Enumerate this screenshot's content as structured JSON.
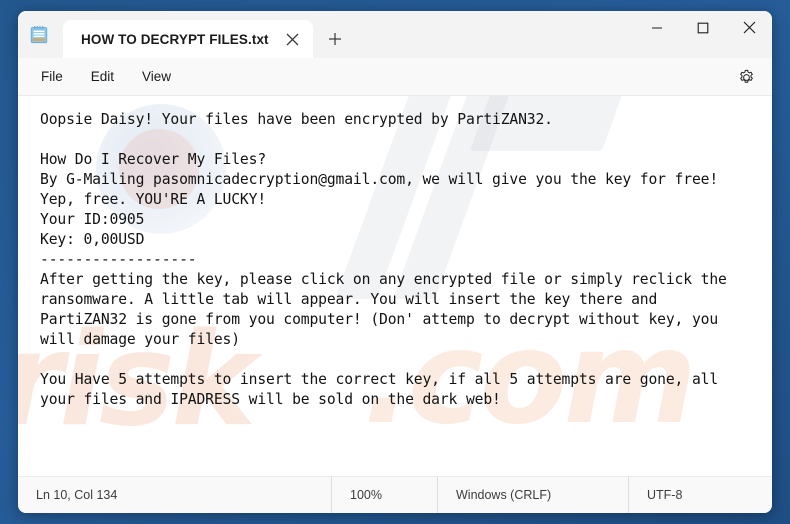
{
  "window": {
    "app_icon": "notepad-icon",
    "controls": {
      "minimize": "minimize-icon",
      "maximize": "maximize-icon",
      "close": "close-icon"
    }
  },
  "tabs": [
    {
      "title": "HOW TO DECRYPT FILES.txt",
      "close_icon": "close-icon",
      "active": true
    }
  ],
  "newtab": {
    "icon": "plus-icon",
    "label": "+"
  },
  "menubar": {
    "items": [
      {
        "label": "File"
      },
      {
        "label": "Edit"
      },
      {
        "label": "View"
      }
    ],
    "settings_icon": "gear-icon"
  },
  "editor": {
    "content": "Oopsie Daisy! Your files have been encrypted by PartiZAN32.\n\nHow Do I Recover My Files?\nBy G-Mailing pasomnicadecryption@gmail.com, we will give you the key for free!\nYep, free. YOU'RE A LUCKY!\nYour ID:0905\nKey: 0,00USD\n------------------\nAfter getting the key, please click on any encrypted file or simply reclick the\nransomware. A little tab will appear. You will insert the key there and\nPartiZAN32 is gone from you computer! (Don' attemp to decrypt without key, you\nwill damage your files)\n\nYou Have 5 attempts to insert the correct key, if all 5 attempts are gone, all\nyour files and IPADRESS will be sold on the dark web!"
  },
  "statusbar": {
    "line_col": "Ln 10, Col 134",
    "zoom": "100%",
    "line_ending": "Windows (CRLF)",
    "encoding": "UTF-8"
  },
  "watermark": {
    "text_left": "risk",
    "text_right": ".com"
  },
  "colors": {
    "desktop": "#245a96",
    "window_chrome": "#f3f3f3",
    "tab_active": "#ffffff",
    "editor_bg": "#ffffff",
    "text": "#131313",
    "close_hover": "#c42b1c"
  }
}
